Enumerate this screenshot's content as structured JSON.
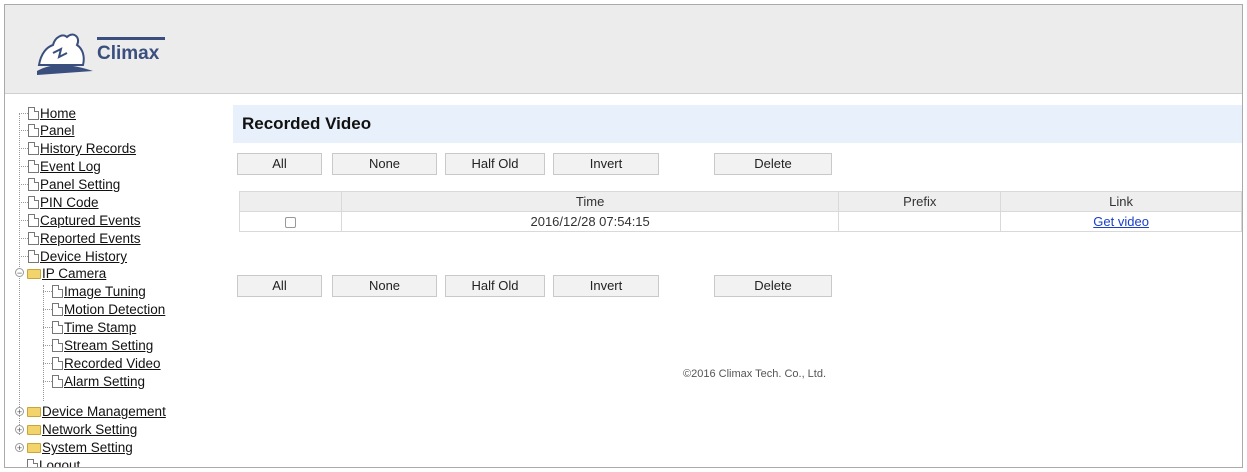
{
  "brand": {
    "name": "Climax"
  },
  "nav": {
    "items": [
      {
        "label": "Home"
      },
      {
        "label": "Panel"
      },
      {
        "label": "History Records"
      },
      {
        "label": "Event Log"
      },
      {
        "label": "Panel Setting"
      },
      {
        "label": "PIN Code"
      },
      {
        "label": "Captured Events"
      },
      {
        "label": "Reported Events"
      },
      {
        "label": "Device History"
      },
      {
        "label": "IP Camera"
      },
      {
        "label": "Image Tuning"
      },
      {
        "label": "Motion Detection"
      },
      {
        "label": "Time Stamp"
      },
      {
        "label": "Stream Setting"
      },
      {
        "label": "Recorded Video"
      },
      {
        "label": "Alarm Setting"
      },
      {
        "label": "Device Management"
      },
      {
        "label": "Network Setting"
      },
      {
        "label": "System Setting"
      },
      {
        "label": "Logout"
      }
    ]
  },
  "page": {
    "title": "Recorded Video"
  },
  "actions": {
    "all": "All",
    "none": "None",
    "half_old": "Half Old",
    "invert": "Invert",
    "delete": "Delete"
  },
  "table": {
    "headers": {
      "select": "",
      "time": "Time",
      "prefix": "Prefix",
      "link": "Link"
    },
    "rows": [
      {
        "checked": false,
        "time": "2016/12/28 07:54:15",
        "prefix": "",
        "link": "Get video"
      }
    ]
  },
  "footer": {
    "copyright": "©2016 Climax Tech. Co., Ltd."
  }
}
